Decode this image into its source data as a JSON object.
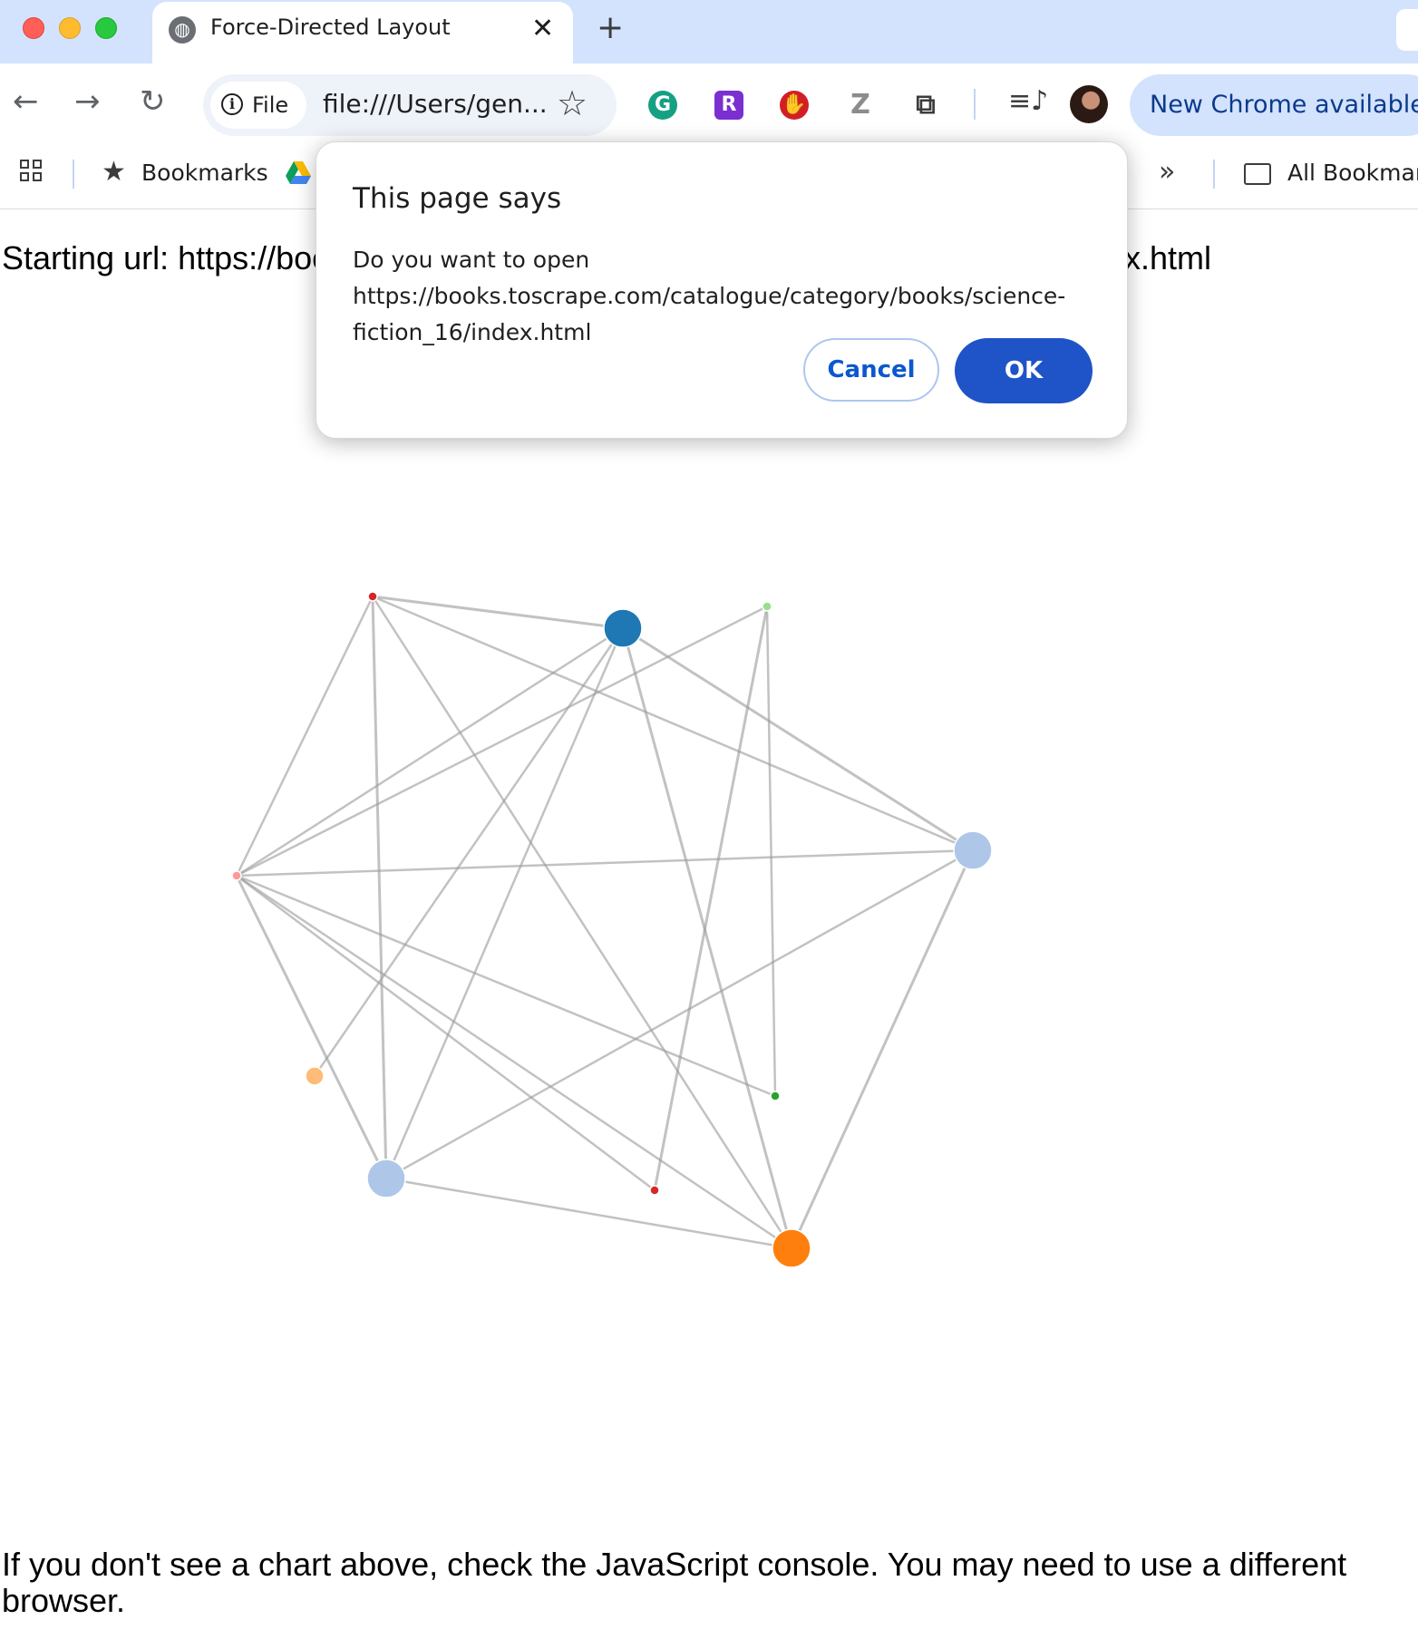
{
  "browser": {
    "tab": {
      "title": "Force-Directed Layout",
      "favicon": "globe-icon",
      "close_glyph": "✕"
    },
    "new_tab_glyph": "+",
    "omnibox": {
      "chip_label": "File",
      "url": "file:///Users/gen..."
    },
    "update_button": "New Chrome available",
    "bookmarks_bar": {
      "bookmarks_label": "Bookmarks",
      "all_bookmarks_label": "All Bookmarks"
    },
    "extensions": [
      "grammarly-icon",
      "r-extension-icon",
      "adblock-stop-icon",
      "z-extension-icon",
      "puzzle-icon"
    ]
  },
  "page": {
    "starting_url_left": "Starting url: https://boo",
    "starting_url_right": "x.html",
    "footer_text": "If you don't see a chart above, check the JavaScript console. You may need to use a different browser."
  },
  "dialog": {
    "title": "This page says",
    "message": "Do you want to open https://books.toscrape.com/catalogue/category/books/science-fiction_16/index.html",
    "cancel_label": "Cancel",
    "ok_label": "OK"
  },
  "chart_data": {
    "type": "network",
    "nodes": [
      {
        "id": 0,
        "color": "#d62728",
        "size": "small"
      },
      {
        "id": 1,
        "color": "#1f77b4",
        "size": "large"
      },
      {
        "id": 2,
        "color": "#98df8a",
        "size": "small"
      },
      {
        "id": 3,
        "color": "#aec7e8",
        "size": "large"
      },
      {
        "id": 4,
        "color": "#ff9896",
        "size": "small"
      },
      {
        "id": 5,
        "color": "#2ca02c",
        "size": "small"
      },
      {
        "id": 6,
        "color": "#ffbb78",
        "size": "medium"
      },
      {
        "id": 7,
        "color": "#d62728",
        "size": "small"
      },
      {
        "id": 8,
        "color": "#aec7e8",
        "size": "large"
      },
      {
        "id": 9,
        "color": "#ff7f0e",
        "size": "large"
      }
    ],
    "links": [
      [
        0,
        1
      ],
      [
        0,
        3
      ],
      [
        0,
        4
      ],
      [
        0,
        8
      ],
      [
        0,
        9
      ],
      [
        1,
        4
      ],
      [
        1,
        3
      ],
      [
        1,
        6
      ],
      [
        1,
        8
      ],
      [
        1,
        9
      ],
      [
        2,
        4
      ],
      [
        2,
        5
      ],
      [
        2,
        7
      ],
      [
        3,
        4
      ],
      [
        3,
        8
      ],
      [
        3,
        9
      ],
      [
        4,
        5
      ],
      [
        4,
        7
      ],
      [
        4,
        8
      ],
      [
        4,
        9
      ],
      [
        8,
        9
      ]
    ]
  }
}
